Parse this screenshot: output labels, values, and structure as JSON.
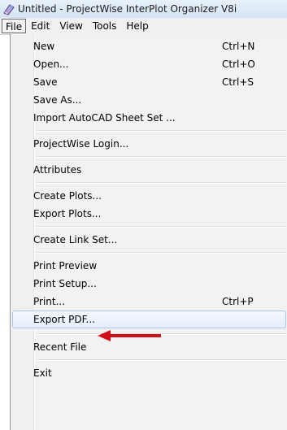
{
  "window": {
    "title": "Untitled - ProjectWise InterPlot Organizer V8i",
    "icon": "projectwise-app-icon"
  },
  "menubar": {
    "items": [
      "File",
      "Edit",
      "View",
      "Tools",
      "Help"
    ],
    "active": "File"
  },
  "file_menu": {
    "items": [
      {
        "label": "New",
        "shortcut": "Ctrl+N"
      },
      {
        "label": "Open...",
        "shortcut": "Ctrl+O"
      },
      {
        "label": "Save",
        "shortcut": "Ctrl+S"
      },
      {
        "label": "Save As...",
        "shortcut": ""
      },
      {
        "label": "Import AutoCAD Sheet Set ...",
        "shortcut": ""
      },
      {
        "label": "ProjectWise Login...",
        "shortcut": ""
      },
      {
        "label": "Attributes",
        "shortcut": ""
      },
      {
        "label": "Create Plots...",
        "shortcut": ""
      },
      {
        "label": "Export Plots...",
        "shortcut": ""
      },
      {
        "label": "Create Link Set...",
        "shortcut": ""
      },
      {
        "label": "Print Preview",
        "shortcut": ""
      },
      {
        "label": "Print Setup...",
        "shortcut": ""
      },
      {
        "label": "Print...",
        "shortcut": "Ctrl+P"
      },
      {
        "label": "Export PDF...",
        "shortcut": ""
      },
      {
        "label": "Recent File",
        "shortcut": ""
      },
      {
        "label": "Exit",
        "shortcut": ""
      }
    ],
    "highlighted": "Export PDF..."
  },
  "annotation": {
    "arrow_color": "#d0101a"
  }
}
